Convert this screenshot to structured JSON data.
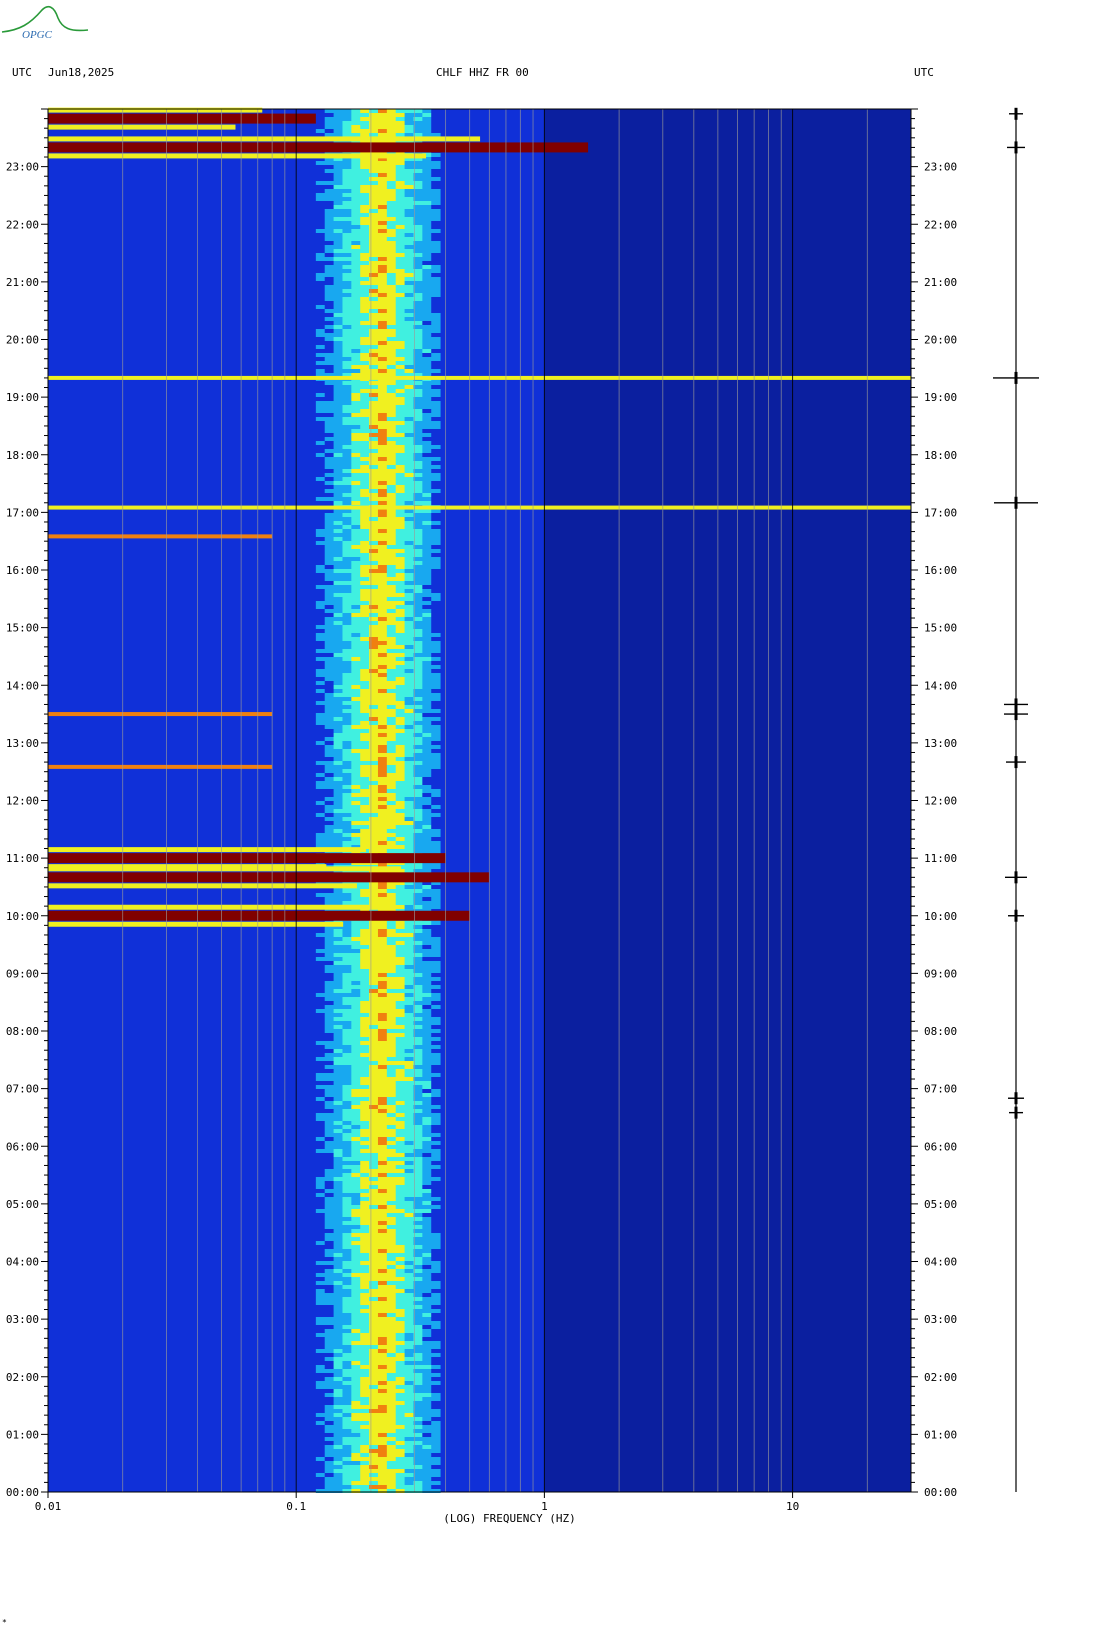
{
  "header": {
    "left_label": "UTC",
    "date": "Jun18,2025",
    "station": "CHLF HHZ FR 00",
    "right_label": "UTC"
  },
  "logo": {
    "text": "OPGC",
    "color": "#2a9a3a"
  },
  "footer_mark": "*",
  "chart_data": {
    "type": "heatmap",
    "title": "CHLF HHZ FR 00",
    "xlabel": "(LOG) FREQUENCY (HZ)",
    "xscale": "log",
    "xlim": [
      0.01,
      30
    ],
    "x_ticks": [
      {
        "value": 0.01,
        "label": "0.01"
      },
      {
        "value": 0.1,
        "label": "0.1"
      },
      {
        "value": 1,
        "label": "1"
      },
      {
        "value": 10,
        "label": "10"
      }
    ],
    "ylabel": "UTC",
    "ylim_hours": [
      0,
      24
    ],
    "y_ticks": [
      "00:00",
      "01:00",
      "02:00",
      "03:00",
      "04:00",
      "05:00",
      "06:00",
      "07:00",
      "08:00",
      "09:00",
      "10:00",
      "11:00",
      "12:00",
      "13:00",
      "14:00",
      "15:00",
      "16:00",
      "17:00",
      "18:00",
      "19:00",
      "20:00",
      "21:00",
      "22:00",
      "23:00"
    ],
    "colormap": [
      "#0a1a8c",
      "#1030d8",
      "#18a8f0",
      "#40f0e0",
      "#f0f020",
      "#f08010",
      "#d01010",
      "#800000"
    ],
    "microseism_band_hz": [
      0.12,
      0.38
    ],
    "microseism_peak_hz": 0.22,
    "events": [
      {
        "time": "10:00",
        "intensity": 0.9,
        "fmax_hz": 0.5
      },
      {
        "time": "10:40",
        "intensity": 1.0,
        "fmax_hz": 0.6
      },
      {
        "time": "11:00",
        "intensity": 0.95,
        "fmax_hz": 0.4
      },
      {
        "time": "12:35",
        "intensity": 0.6,
        "fmax_hz": 0.08
      },
      {
        "time": "13:30",
        "intensity": 0.5,
        "fmax_hz": 0.08
      },
      {
        "time": "16:35",
        "intensity": 0.55,
        "fmax_hz": 0.08
      },
      {
        "time": "17:05",
        "intensity": 0.4,
        "fmax_hz": 30
      },
      {
        "time": "19:20",
        "intensity": 0.35,
        "fmax_hz": 30
      },
      {
        "time": "23:20",
        "intensity": 1.0,
        "fmax_hz": 1.5
      },
      {
        "time": "23:50",
        "intensity": 1.0,
        "fmax_hz": 0.12
      }
    ],
    "seismogram_events": [
      {
        "time": "06:35",
        "amplitude": 0.15
      },
      {
        "time": "06:50",
        "amplitude": 0.2
      },
      {
        "time": "10:00",
        "amplitude": 0.2
      },
      {
        "time": "10:40",
        "amplitude": 0.35
      },
      {
        "time": "12:40",
        "amplitude": 0.3
      },
      {
        "time": "13:30",
        "amplitude": 0.4
      },
      {
        "time": "13:40",
        "amplitude": 0.4
      },
      {
        "time": "17:10",
        "amplitude": 0.9
      },
      {
        "time": "19:20",
        "amplitude": 0.95
      },
      {
        "time": "23:20",
        "amplitude": 0.25
      },
      {
        "time": "23:55",
        "amplitude": 0.15
      }
    ]
  }
}
